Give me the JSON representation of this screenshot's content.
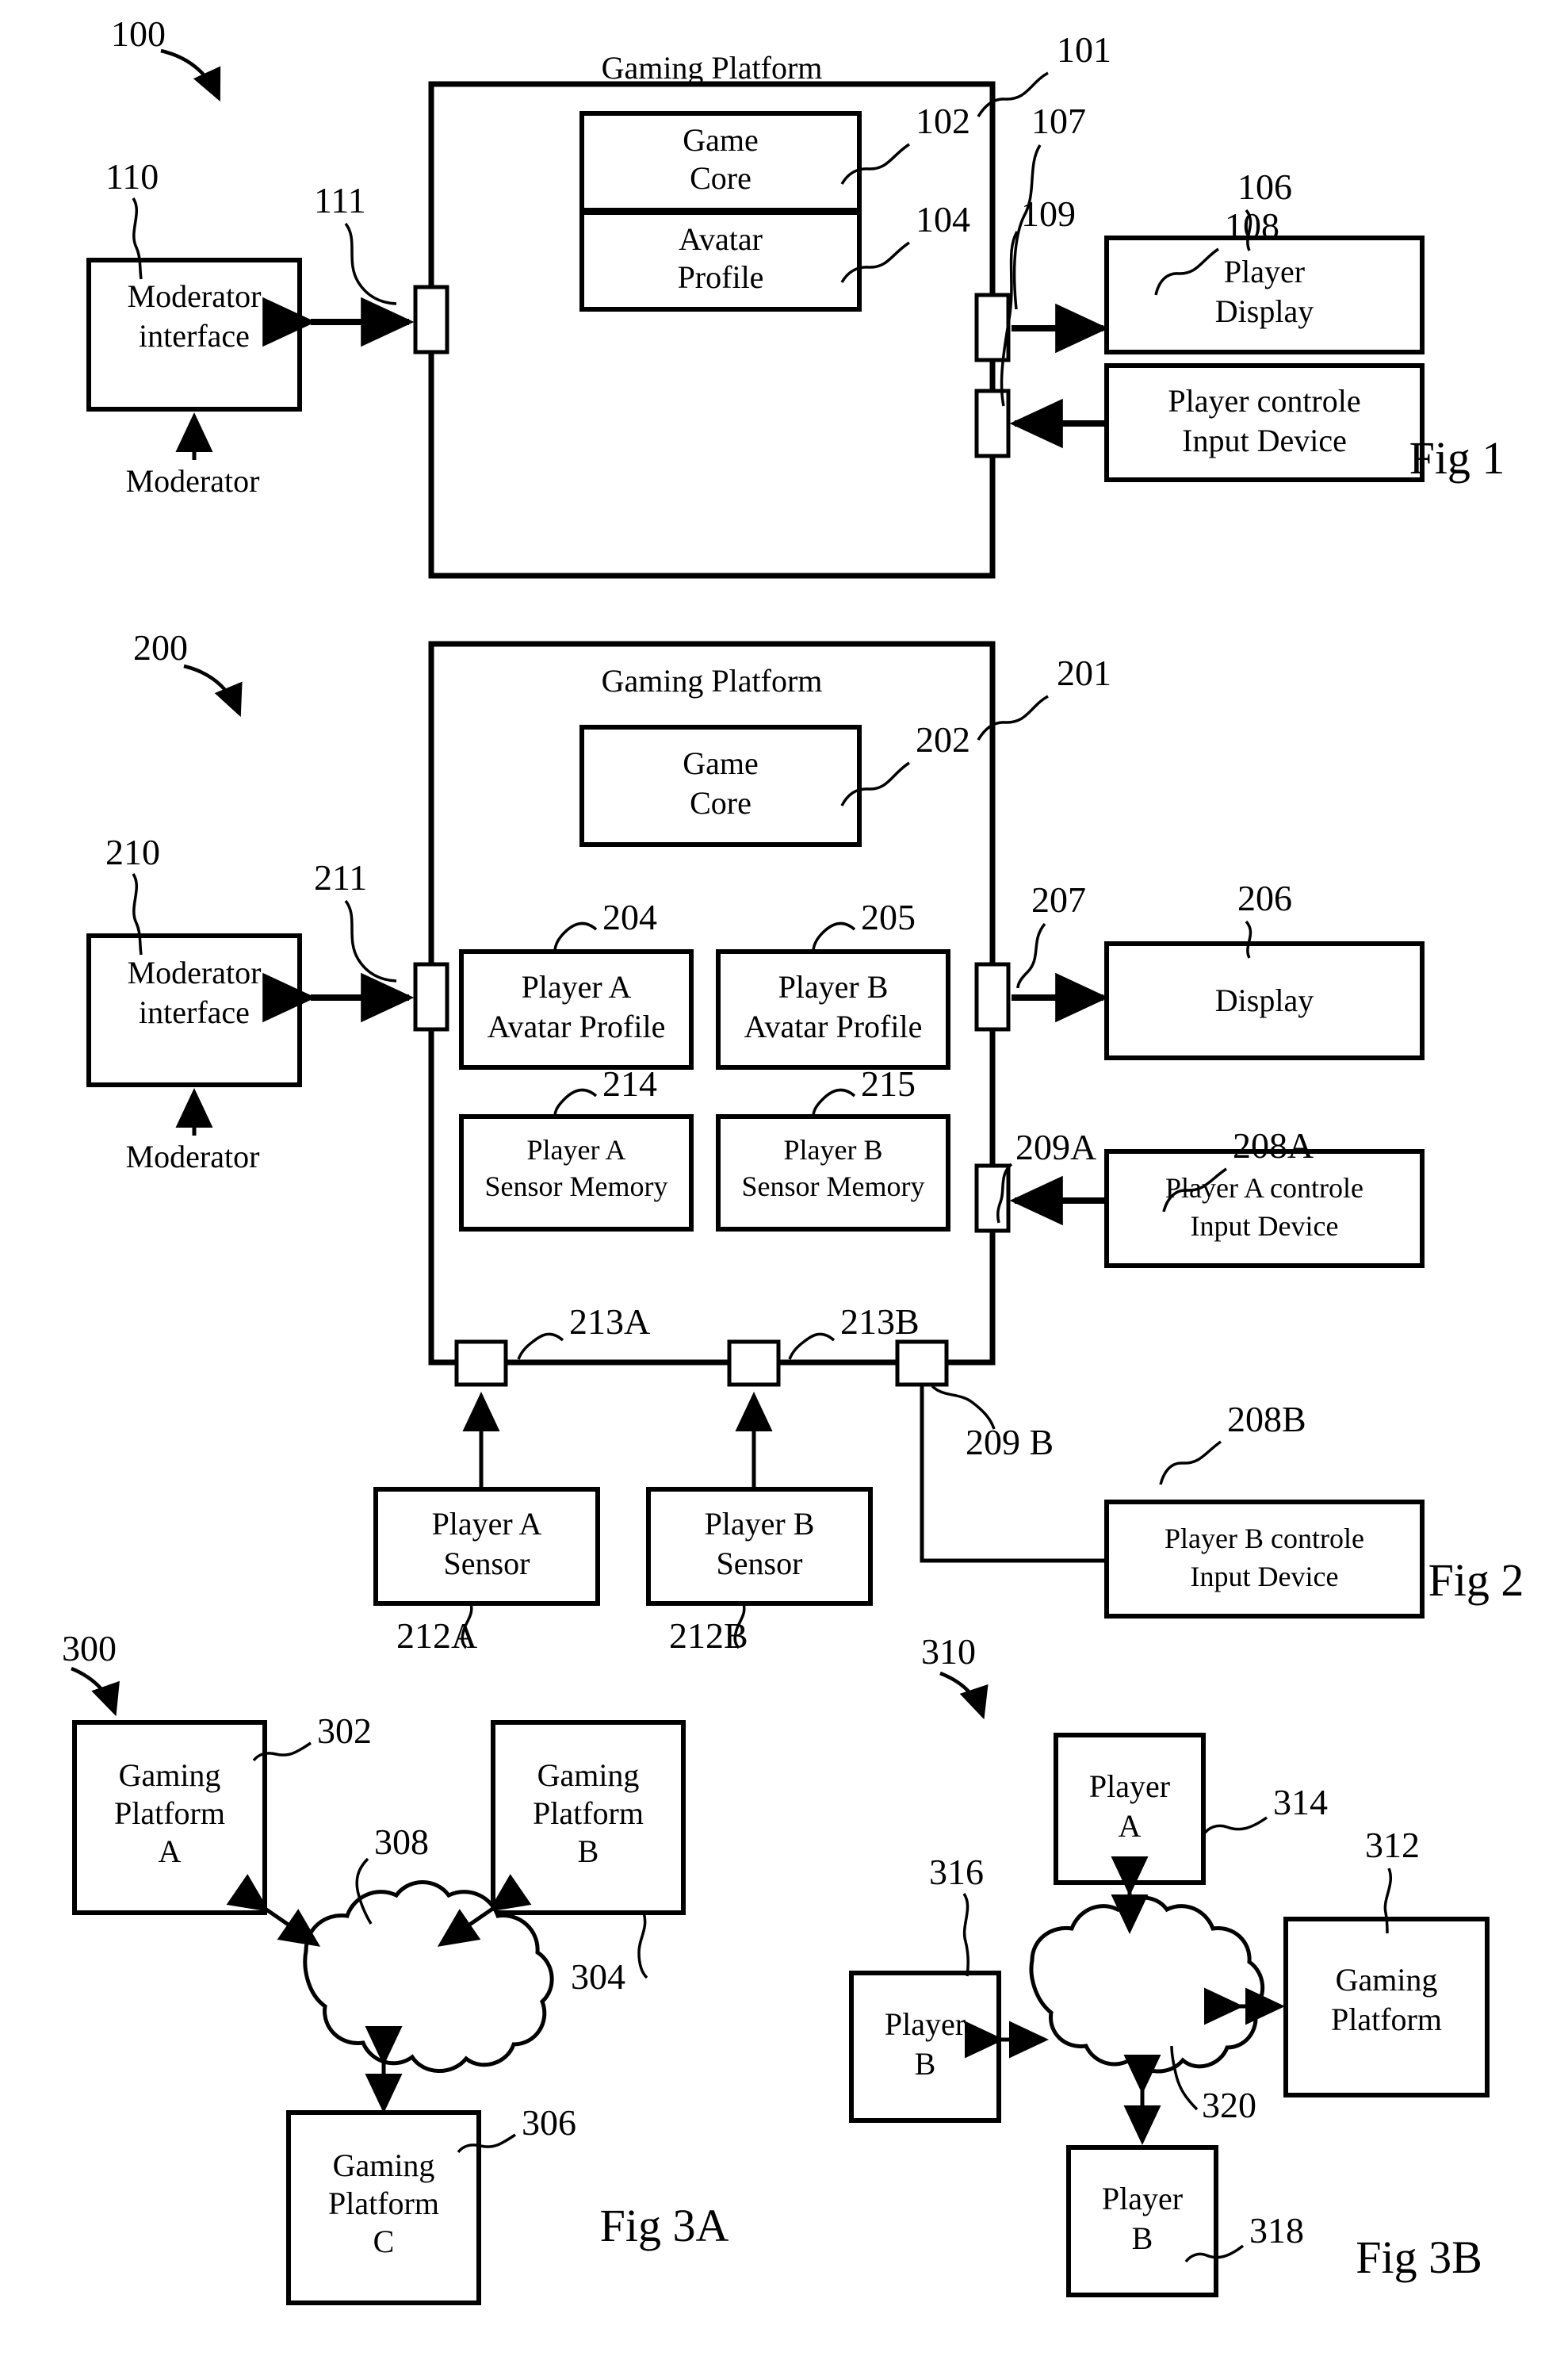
{
  "document": {
    "kind": "patent-drawing-sheet",
    "figures": [
      "Fig 1",
      "Fig 2",
      "Fig 3A",
      "Fig 3B"
    ]
  },
  "fig1": {
    "caption": "Fig 1",
    "system_ref": "100",
    "platform": {
      "title": "Gaming Platform",
      "ref": "101"
    },
    "blocks": {
      "game_core": {
        "label_line1": "Game",
        "label_line2": "Core",
        "ref": "102"
      },
      "avatar_profile": {
        "label_line1": "Avatar",
        "label_line2": "Profile",
        "ref": "104"
      },
      "moderator_interface": {
        "label_line1": "Moderator",
        "label_line2": "interface",
        "ref": "110"
      },
      "moderator_actor": {
        "label": "Moderator"
      },
      "player_display": {
        "label_line1": "Player",
        "label_line2": "Display",
        "ref": "106"
      },
      "player_input": {
        "label_line1": "Player controle",
        "label_line2": "Input Device",
        "ref": "108"
      }
    },
    "ports": {
      "moderator_port": "111",
      "display_port": "107",
      "input_port": "109"
    }
  },
  "fig2": {
    "caption": "Fig 2",
    "system_ref": "200",
    "platform": {
      "title": "Gaming Platform",
      "ref": "201"
    },
    "blocks": {
      "game_core": {
        "label_line1": "Game",
        "label_line2": "Core",
        "ref": "202"
      },
      "player_a_avatar": {
        "label_line1": "Player A",
        "label_line2": "Avatar Profile",
        "ref": "204"
      },
      "player_b_avatar": {
        "label_line1": "Player B",
        "label_line2": "Avatar Profile",
        "ref": "205"
      },
      "player_a_sensor_memory": {
        "label_line1": "Player A",
        "label_line2": "Sensor Memory",
        "ref": "214"
      },
      "player_b_sensor_memory": {
        "label_line1": "Player B",
        "label_line2": "Sensor Memory",
        "ref": "215"
      },
      "moderator_interface": {
        "label_line1": "Moderator",
        "label_line2": "interface",
        "ref": "210"
      },
      "moderator_actor": {
        "label": "Moderator"
      },
      "display": {
        "label": "Display",
        "ref": "206"
      },
      "player_a_input": {
        "label_line1": "Player A controle",
        "label_line2": "Input Device",
        "ref": "208A"
      },
      "player_b_input": {
        "label_line1": "Player B controle",
        "label_line2": "Input Device",
        "ref": "208B"
      },
      "player_a_sensor": {
        "label_line1": "Player A",
        "label_line2": "Sensor",
        "ref": "212A"
      },
      "player_b_sensor": {
        "label_line1": "Player B",
        "label_line2": "Sensor",
        "ref": "212B"
      }
    },
    "ports": {
      "moderator_port": "211",
      "display_port": "207",
      "input_a_port": "209A",
      "input_b_port": "209 B",
      "sensor_a_port": "213A",
      "sensor_b_port": "213B"
    }
  },
  "fig3a": {
    "caption": "Fig 3A",
    "system_ref": "300",
    "nodes": [
      {
        "label_line1": "Gaming",
        "label_line2": "Platform",
        "label_line3": "A",
        "ref": "302"
      },
      {
        "label_line1": "Gaming",
        "label_line2": "Platform",
        "label_line3": "B",
        "ref": "304"
      },
      {
        "label_line1": "Gaming",
        "label_line2": "Platform",
        "label_line3": "C",
        "ref": "306"
      }
    ],
    "cloud": {
      "name": "network-cloud",
      "ref": "308"
    }
  },
  "fig3b": {
    "caption": "Fig 3B",
    "system_ref": "310",
    "nodes": [
      {
        "label_line1": "Player",
        "label_line2": "A",
        "ref": "314"
      },
      {
        "label_line1": "Player",
        "label_line2": "B",
        "ref": "316"
      },
      {
        "label_line1": "Player",
        "label_line2": "B",
        "ref": "318"
      },
      {
        "label_line1": "Gaming",
        "label_line2": "Platform",
        "ref": "312"
      }
    ],
    "cloud": {
      "name": "network-cloud",
      "ref": "320"
    }
  },
  "colors": {
    "ink": "#000000",
    "paper": "#ffffff"
  }
}
